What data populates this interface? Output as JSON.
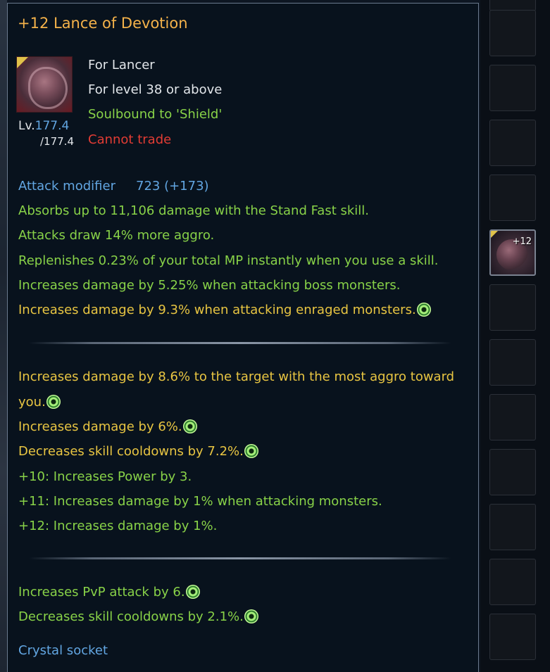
{
  "tooltip": {
    "title": "+12 Lance of Devotion",
    "class_line": "For Lancer",
    "level_line": "For level 38 or above",
    "soulbound": "Soulbound to 'Shield'",
    "trade": "Cannot trade",
    "item_level_prefix": "Lv.",
    "item_level": "177.4",
    "item_level_max": "/177.4",
    "attack_label": "Attack modifier",
    "attack_value": "723 (+173)",
    "stats": [
      "Absorbs up to 11,106 damage with the Stand Fast skill.",
      "Attacks draw 14% more aggro.",
      "Replenishes 0.23% of your total MP instantly when you use a skill.",
      "Increases damage by 5.25% when attacking boss monsters.",
      "Increases damage by 9.3% when attacking enraged monsters."
    ],
    "rolls": [
      "Increases damage by 8.6% to the target with the most aggro toward",
      "you.",
      "Increases damage by 6%.",
      "Decreases skill cooldowns by 7.2%."
    ],
    "enchants": [
      "+10: Increases Power by 3.",
      "+11: Increases damage by 1% when attacking monsters.",
      "+12: Increases damage by 1%."
    ],
    "pvp_rolls": [
      "Increases PvP attack by 6.",
      "Decreases skill cooldowns by 2.1%."
    ],
    "sockets": [
      "Crystal socket"
    ],
    "icon": "lance-item-icon",
    "reroll_icon": "green-swirl-icon"
  },
  "inventory": {
    "slot_enchant": "+12"
  },
  "colors": {
    "green": "#88d248",
    "yellow": "#e8c542",
    "blue": "#62a6e2",
    "red": "#e23c34",
    "orange": "#f4b24a"
  }
}
